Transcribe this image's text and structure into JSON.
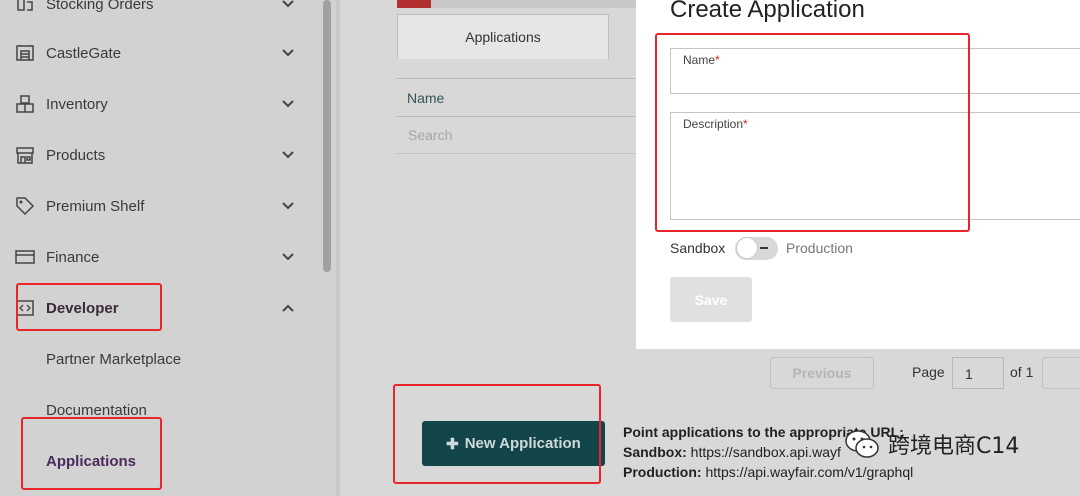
{
  "sidebar": {
    "items": [
      {
        "label": "Stocking Orders",
        "icon": "stocking-orders-icon",
        "state": "collapsed"
      },
      {
        "label": "CastleGate",
        "icon": "warehouse-icon",
        "state": "collapsed"
      },
      {
        "label": "Inventory",
        "icon": "boxes-icon",
        "state": "collapsed"
      },
      {
        "label": "Products",
        "icon": "storefront-icon",
        "state": "collapsed"
      },
      {
        "label": "Premium Shelf",
        "icon": "tag-icon",
        "state": "collapsed"
      },
      {
        "label": "Finance",
        "icon": "credit-card-icon",
        "state": "collapsed"
      },
      {
        "label": "Developer",
        "icon": "code-icon",
        "state": "expanded"
      }
    ],
    "sub_items": [
      {
        "label": "Partner Marketplace"
      },
      {
        "label": "Documentation"
      },
      {
        "label": "Applications"
      }
    ]
  },
  "main": {
    "tab_label": "Applications",
    "table": {
      "column_name": "Name",
      "search_placeholder": "Search"
    },
    "pagination": {
      "previous": "Previous",
      "page_label": "Page",
      "page_value": "1",
      "of_label": "of 1"
    },
    "new_application_label": "New Application",
    "info": {
      "heading": "Point applications to the appropriate URL:",
      "sandbox_label": "Sandbox:",
      "sandbox_url": "https://sandbox.api.wayf",
      "production_label": "Production:",
      "production_url": "https://api.wayfair.com/v1/graphql"
    }
  },
  "modal": {
    "title": "Create Application",
    "name_label": "Name",
    "description_label": "Description",
    "required_mark": "*",
    "sandbox_label": "Sandbox",
    "production_label": "Production",
    "save_label": "Save"
  },
  "watermark": {
    "text": "跨境电商C14"
  },
  "colors": {
    "accent": "#12454a",
    "highlight": "#e8262a",
    "required": "#d02020"
  }
}
